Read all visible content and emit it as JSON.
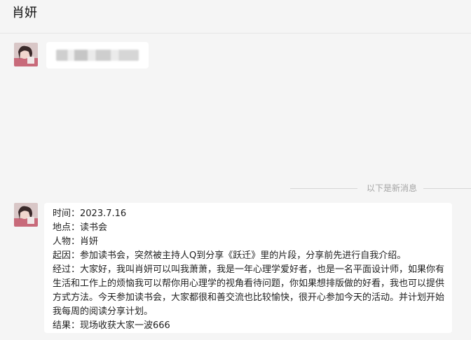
{
  "header": {
    "title": "肖妍"
  },
  "divider": {
    "text": "以下是新消息"
  },
  "message": {
    "lines": [
      "时间：2023.7.16",
      "地点：读书会",
      "人物：肖妍",
      "起因：参加读书会，突然被主持人Q到分享《跃迁》里的片段，分享前先进行自我介绍。",
      "经过：大家好，我叫肖妍可以叫我萧萧，我是一年心理学爱好者，也是一名平面设计师，如果你有生活和工作上的烦恼我可以帮你用心理学的视角看待问题，你如果想排版做的好看，我也可以提供方式方法。今天参加读书会，大家都很和善交流也比较愉快，很开心参加今天的活动。并计划开始我每周的阅读分享计划。",
      "结果：现场收获大家一波666"
    ]
  },
  "colors": {
    "background": "#f5f5f5",
    "bubble": "#ffffff",
    "divider": "#d6d6d6",
    "divider_text": "#a5a5a5"
  }
}
